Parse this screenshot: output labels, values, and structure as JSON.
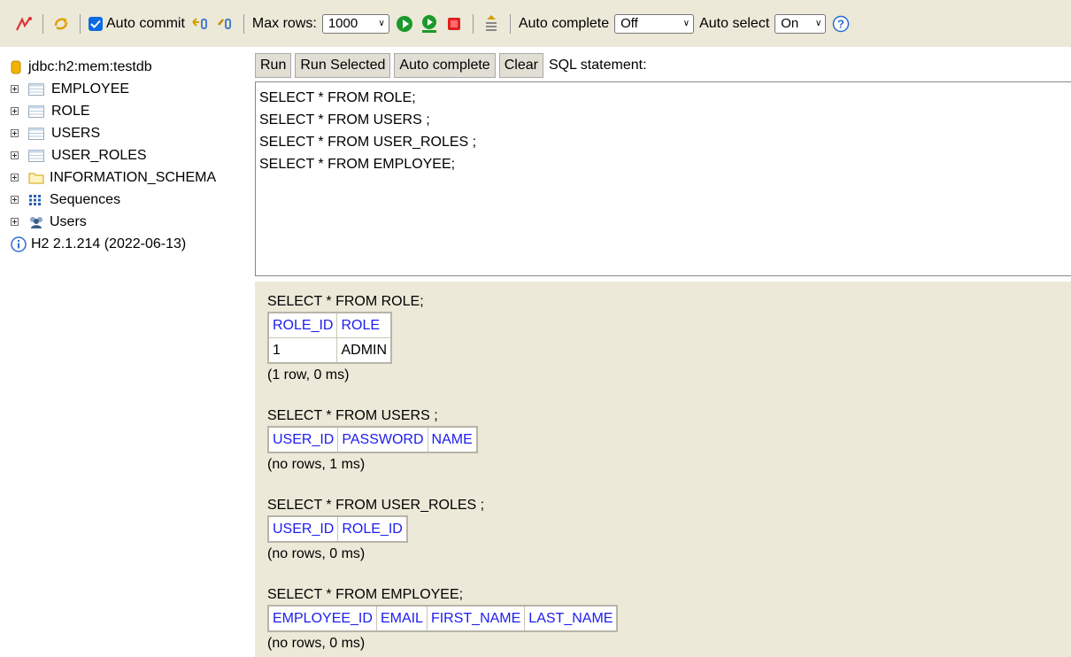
{
  "toolbar": {
    "auto_commit_label": "Auto commit",
    "max_rows_label": "Max rows:",
    "max_rows_value": "1000",
    "auto_complete_label": "Auto complete",
    "auto_complete_value": "Off",
    "auto_select_label": "Auto select",
    "auto_select_value": "On"
  },
  "tree": {
    "connection": "jdbc:h2:mem:testdb",
    "tables": [
      "EMPLOYEE",
      "ROLE",
      "USERS",
      "USER_ROLES"
    ],
    "schema": "INFORMATION_SCHEMA",
    "sequences": "Sequences",
    "users": "Users",
    "version": "H2 2.1.214 (2022-06-13)"
  },
  "sql_toolbar": {
    "run": "Run",
    "run_selected": "Run Selected",
    "auto_complete": "Auto complete",
    "clear": "Clear",
    "label": "SQL statement:"
  },
  "editor": {
    "lines": [
      "SELECT * FROM ROLE;",
      "SELECT * FROM USERS ;",
      "SELECT * FROM USER_ROLES ;",
      "SELECT * FROM EMPLOYEE;"
    ]
  },
  "results": [
    {
      "sql": "SELECT * FROM ROLE;",
      "columns": [
        "ROLE_ID",
        "ROLE"
      ],
      "rows": [
        [
          "1",
          "ADMIN"
        ]
      ],
      "meta": "(1 row, 0 ms)"
    },
    {
      "sql": "SELECT * FROM USERS ;",
      "columns": [
        "USER_ID",
        "PASSWORD",
        "NAME"
      ],
      "rows": [],
      "meta": "(no rows, 1 ms)"
    },
    {
      "sql": "SELECT * FROM USER_ROLES ;",
      "columns": [
        "USER_ID",
        "ROLE_ID"
      ],
      "rows": [],
      "meta": "(no rows, 0 ms)"
    },
    {
      "sql": "SELECT * FROM EMPLOYEE;",
      "columns": [
        "EMPLOYEE_ID",
        "EMAIL",
        "FIRST_NAME",
        "LAST_NAME"
      ],
      "rows": [],
      "meta": "(no rows, 0 ms)"
    }
  ]
}
